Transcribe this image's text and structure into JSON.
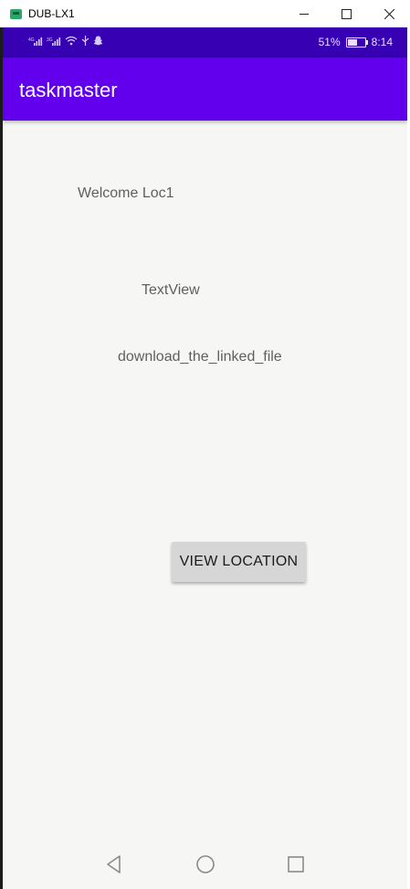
{
  "window": {
    "title": "DUB-LX1",
    "icon": "android-device-icon",
    "controls": [
      "minimize-icon",
      "maximize-icon",
      "close-icon"
    ]
  },
  "status_bar": {
    "signal1": "4G",
    "signal2": "3G",
    "battery_percent": "51%",
    "battery_level": 0.51,
    "time": "8:14",
    "icons": [
      "signal-icon",
      "signal-icon",
      "wifi-icon",
      "usb-icon",
      "snapchat-icon",
      "battery-icon"
    ],
    "background": "#3700b3"
  },
  "app_bar": {
    "title": "taskmaster",
    "background": "#6200ee"
  },
  "content": {
    "welcome_text": "Welcome Loc1",
    "textview_text": "TextView",
    "download_text": "download_the_linked_file",
    "view_location_button": "VIEW LOCATION"
  },
  "nav_bar": {
    "icons": [
      "back-icon",
      "home-icon",
      "recents-icon"
    ]
  }
}
